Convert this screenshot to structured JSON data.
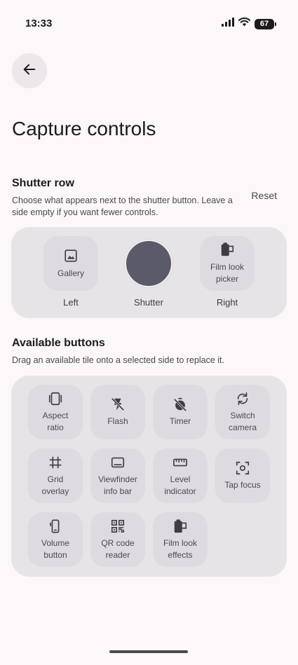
{
  "status_bar": {
    "time": "13:33",
    "battery": "67"
  },
  "page": {
    "title": "Capture controls"
  },
  "shutter_row": {
    "title": "Shutter row",
    "description": "Choose what appears next to the shutter button. Leave a side empty if you want fewer controls.",
    "reset_label": "Reset",
    "left": {
      "tile_label": "Gallery",
      "icon": "image-icon",
      "caption": "Left"
    },
    "center": {
      "caption": "Shutter"
    },
    "right": {
      "tile_label": "Film look picker",
      "icon": "film-canister-icon",
      "caption": "Right"
    }
  },
  "available": {
    "title": "Available buttons",
    "description": "Drag an available tile onto a selected side to replace it.",
    "tiles": [
      {
        "label": "Aspect ratio",
        "icon": "aspect-ratio-icon"
      },
      {
        "label": "Flash",
        "icon": "flash-off-icon"
      },
      {
        "label": "Timer",
        "icon": "timer-off-icon"
      },
      {
        "label": "Switch camera",
        "icon": "switch-camera-icon"
      },
      {
        "label": "Grid overlay",
        "icon": "grid-icon"
      },
      {
        "label": "Viewfinder info bar",
        "icon": "info-bar-icon"
      },
      {
        "label": "Level indicator",
        "icon": "ruler-icon"
      },
      {
        "label": "Tap focus",
        "icon": "focus-icon"
      },
      {
        "label": "Volume button",
        "icon": "phone-volume-icon"
      },
      {
        "label": "QR code reader",
        "icon": "qr-code-icon"
      },
      {
        "label": "Film look effects",
        "icon": "film-canister-icon"
      }
    ]
  },
  "colors": {
    "background": "#fcf7f8",
    "panel": "#e7e4e8",
    "tile": "#dedbe0",
    "shutter": "#5b5a69",
    "text": "#1d1b1e"
  }
}
